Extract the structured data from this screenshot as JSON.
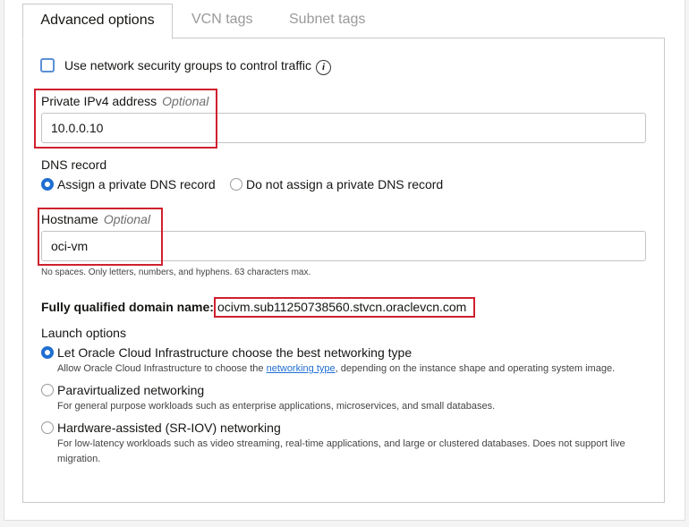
{
  "tabs": [
    {
      "label": "Advanced options"
    },
    {
      "label": "VCN tags"
    },
    {
      "label": "Subnet tags"
    }
  ],
  "nsg": {
    "label": "Use network security groups to control traffic",
    "info_glyph": "i"
  },
  "private_ip": {
    "label": "Private IPv4 address",
    "optional": "Optional",
    "value": "10.0.0.10"
  },
  "dns": {
    "label": "DNS record",
    "options": [
      "Assign a private DNS record",
      "Do not assign a private DNS record"
    ],
    "selected": 0
  },
  "hostname": {
    "label": "Hostname",
    "optional": "Optional",
    "value": "oci-vm",
    "help": "No spaces. Only letters, numbers, and hyphens. 63 characters max."
  },
  "fqdn": {
    "label": "Fully qualified domain name:",
    "value": "ocivm.sub11250738560.stvcn.oraclevcn.com"
  },
  "launch": {
    "label": "Launch options",
    "options": [
      {
        "title": "Let Oracle Cloud Infrastructure choose the best networking type",
        "desc_before": "Allow Oracle Cloud Infrastructure to choose the",
        "desc_link": "networking type",
        "desc_after": ", depending on the instance shape and operating system image."
      },
      {
        "title": "Paravirtualized networking",
        "desc": "For general purpose workloads such as enterprise applications, microservices, and small databases."
      },
      {
        "title": "Hardware-assisted (SR-IOV) networking",
        "desc_line1": "For low-latency workloads such as video streaming, real-time applications, and large or clustered databases. Does not support live",
        "desc_line2": "migration."
      }
    ],
    "selected": 0
  },
  "colors": {
    "accent": "#1f6fd1",
    "highlight_box": "#d0202e",
    "checkbox_border": "#5b8fd6"
  }
}
